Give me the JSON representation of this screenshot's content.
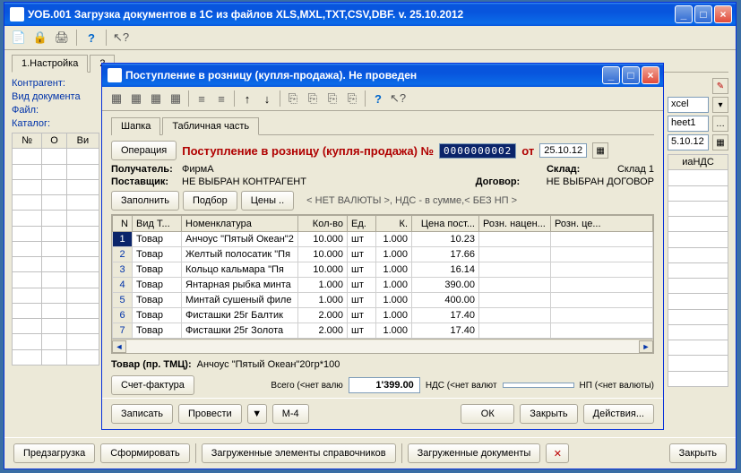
{
  "main_window": {
    "title": "УОБ.001 Загрузка документов в 1С из файлов XLS,MXL,TXT,CSV,DBF.  v. 25.10.2012",
    "tabs": [
      "1.Настройка",
      "2"
    ],
    "labels": {
      "contragent": "Контрагент:",
      "doctype": "Вид документа",
      "file": "Файл:",
      "catalog": "Каталог:"
    },
    "right_col": {
      "xcel": "xcel",
      "heet1": "heet1",
      "date": "5.10.12"
    },
    "bg_headers": [
      "№",
      "О",
      "Ви"
    ],
    "bg_header_right": "иаНДС",
    "bottom_buttons": {
      "preload": "Предзагрузка",
      "form": "Сформировать",
      "loaded_dir": "Загруженные элементы справочников",
      "loaded_docs": "Загруженные документы",
      "close": "Закрыть"
    }
  },
  "dialog": {
    "title": "Поступление в розницу (купля-продажа). Не проведен",
    "tabs": {
      "header": "Шапка",
      "table": "Табличная часть"
    },
    "op_btn": "Операция",
    "doc_title": "Поступление в розницу (купля-продажа) №",
    "doc_num": "0000000002",
    "ot": "от",
    "doc_date": "25.10.12",
    "kv": {
      "recipient_k": "Получатель:",
      "recipient_v": "ФирмА",
      "supplier_k": "Поставщик:",
      "supplier_v": "НЕ ВЫБРАН КОНТРАГЕНТ",
      "warehouse_k": "Склад:",
      "warehouse_v": "Склад 1",
      "contract_k": "Договор:",
      "contract_v": "НЕ ВЫБРАН ДОГОВОР"
    },
    "fill_btn": "Заполнить",
    "pick_btn": "Подбор",
    "price_btn": "Цены ..",
    "currency_note": "< НЕТ ВАЛЮТЫ >, НДС - в сумме,< БЕЗ НП >",
    "grid_headers": {
      "n": "N",
      "type": "Вид Т...",
      "nomen": "Номенклатура",
      "qty": "Кол-во",
      "unit": "Ед.",
      "k": "К.",
      "price": "Цена пост...",
      "margin": "Розн. нацен...",
      "retail": "Розн. це..."
    },
    "rows": [
      {
        "n": 1,
        "type": "Товар",
        "nomen": "Анчоус \"Пятый Океан\"2",
        "qty": "10.000",
        "unit": "шт",
        "k": "1.000",
        "price": "10.23"
      },
      {
        "n": 2,
        "type": "Товар",
        "nomen": "Желтый полосатик \"Пя",
        "qty": "10.000",
        "unit": "шт",
        "k": "1.000",
        "price": "17.66"
      },
      {
        "n": 3,
        "type": "Товар",
        "nomen": "Кольцо кальмара \"Пя",
        "qty": "10.000",
        "unit": "шт",
        "k": "1.000",
        "price": "16.14"
      },
      {
        "n": 4,
        "type": "Товар",
        "nomen": "Янтарная рыбка минта",
        "qty": "1.000",
        "unit": "шт",
        "k": "1.000",
        "price": "390.00"
      },
      {
        "n": 5,
        "type": "Товар",
        "nomen": "Минтай сушеный филе",
        "qty": "1.000",
        "unit": "шт",
        "k": "1.000",
        "price": "400.00"
      },
      {
        "n": 6,
        "type": "Товар",
        "nomen": "Фисташки 25г Балтик",
        "qty": "2.000",
        "unit": "шт",
        "k": "1.000",
        "price": "17.40"
      },
      {
        "n": 7,
        "type": "Товар",
        "nomen": "Фисташки 25г Золота",
        "qty": "2.000",
        "unit": "шт",
        "k": "1.000",
        "price": "17.40"
      }
    ],
    "footer": {
      "tovar_lbl": "Товар (пр. ТМЦ):",
      "tovar_val": "Анчоус \"Пятый Океан\"20гр*100",
      "invoice_btn": "Счет-фактура",
      "total_lbl": "Всего (<нет валю",
      "total_val": "1'399.00",
      "nds_lbl": "НДС (<нет валют",
      "np_lbl": "НП (<нет валюты)"
    },
    "action_buttons": {
      "save": "Записать",
      "post": "Провести",
      "m4": "М-4",
      "ok": "ОК",
      "close": "Закрыть",
      "actions": "Действия..."
    }
  }
}
